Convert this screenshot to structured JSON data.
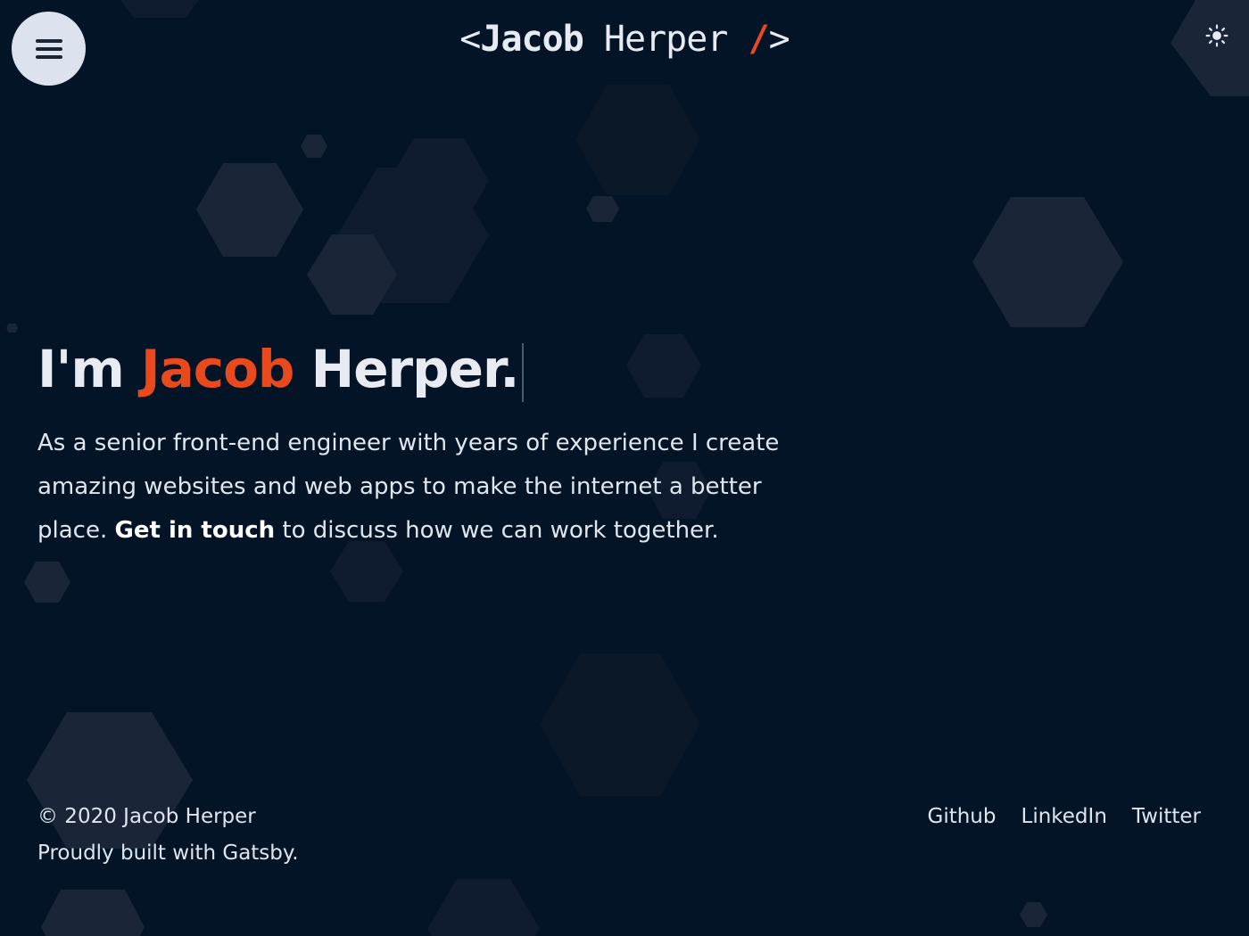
{
  "header": {
    "menu_icon": "hamburger-menu-icon",
    "logo": {
      "open_bracket": "<",
      "first_name": "Jacob",
      "last_name": "Herper",
      "slash": "/",
      "close_bracket": ">"
    },
    "theme_icon": "sun-icon"
  },
  "hero": {
    "title_prefix": "I'm",
    "title_accent": "Jacob",
    "title_suffix": "Herper.",
    "paragraph_before": "As a senior front-end engineer with years of experience I create amazing websites and web apps to make the internet a better place.",
    "link_text": "Get in touch",
    "paragraph_after": "to discuss how we can work together."
  },
  "footer": {
    "copyright": "© 2020 Jacob Herper",
    "built_with": "Proudly built with Gatsby.",
    "links": [
      {
        "label": "Github"
      },
      {
        "label": "LinkedIn"
      },
      {
        "label": "Twitter"
      }
    ]
  },
  "colors": {
    "background": "#021426",
    "accent": "#e8491d",
    "text": "#e8ecf2",
    "menu_button": "#dde3ee"
  }
}
